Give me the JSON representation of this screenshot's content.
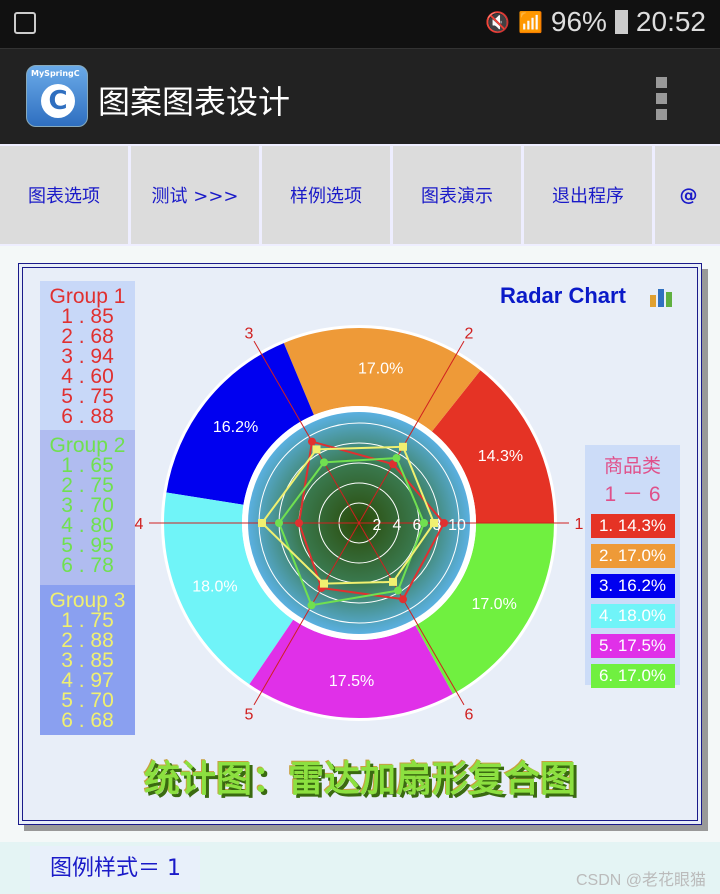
{
  "status": {
    "battery": "96%",
    "time": "20:52",
    "icons": [
      "gallery-icon",
      "mute-icon",
      "wifi-icon",
      "signal-icon",
      "battery-icon"
    ]
  },
  "app": {
    "logo_text": "MySpringC",
    "logo_letter": "C",
    "title": "图案图表设计"
  },
  "toolbar": [
    "图表选项",
    "测试  >>>",
    "样例选项",
    "图表演示",
    "退出程序",
    "@"
  ],
  "chart_data": {
    "type": "radar+pie",
    "title": "Radar Chart",
    "subtitle": "统计图：雷达加扇形复合图",
    "axes": [
      "1",
      "2",
      "3",
      "4",
      "5",
      "6"
    ],
    "radial_ticks": [
      "2",
      "4",
      "6",
      "8",
      "10"
    ],
    "rmax": 100,
    "series": [
      {
        "name": "Group 1",
        "color": "#e03030",
        "values": [
          85,
          68,
          94,
          60,
          75,
          88
        ]
      },
      {
        "name": "Group 2",
        "color": "#70e050",
        "values": [
          65,
          75,
          70,
          80,
          95,
          78
        ]
      },
      {
        "name": "Group 3",
        "color": "#f0f070",
        "values": [
          75,
          88,
          85,
          97,
          70,
          68
        ]
      }
    ],
    "pie": {
      "legend_title": "商品类",
      "legend_subtitle": "1 － 6",
      "labels": [
        "1. 14.3%",
        "2. 17.0%",
        "3. 16.2%",
        "4. 18.0%",
        "5. 17.5%",
        "6. 17.0%"
      ],
      "slice_labels": [
        "14.3%",
        "17.0%",
        "16.2%",
        "18.0%",
        "17.5%",
        "17.0%"
      ],
      "values": [
        14.3,
        17.0,
        16.2,
        18.0,
        17.5,
        17.0
      ],
      "colors": [
        "#e53325",
        "#ee9a38",
        "#0000f0",
        "#70f4f8",
        "#e030e8",
        "#70f040"
      ]
    },
    "legend_placement": "left"
  },
  "groups": [
    {
      "name": "Group 1",
      "lines": [
        "1 . 85",
        "2 . 68",
        "3 . 94",
        "4 . 60",
        "5 . 75",
        "6 . 88"
      ],
      "bg": "#c8d8f8"
    },
    {
      "name": "Group 2",
      "lines": [
        "1 . 65",
        "2 . 75",
        "3 . 70",
        "4 . 80",
        "5 . 95",
        "6 . 78"
      ],
      "bg": "#b0bcf0"
    },
    {
      "name": "Group 3",
      "lines": [
        "1 . 75",
        "2 . 88",
        "3 . 85",
        "4 . 97",
        "5 . 70",
        "6 . 68"
      ],
      "bg": "#8aa0f0"
    }
  ],
  "footer": {
    "label": "图例样式＝ 1",
    "watermark": "CSDN @老花眼猫"
  }
}
